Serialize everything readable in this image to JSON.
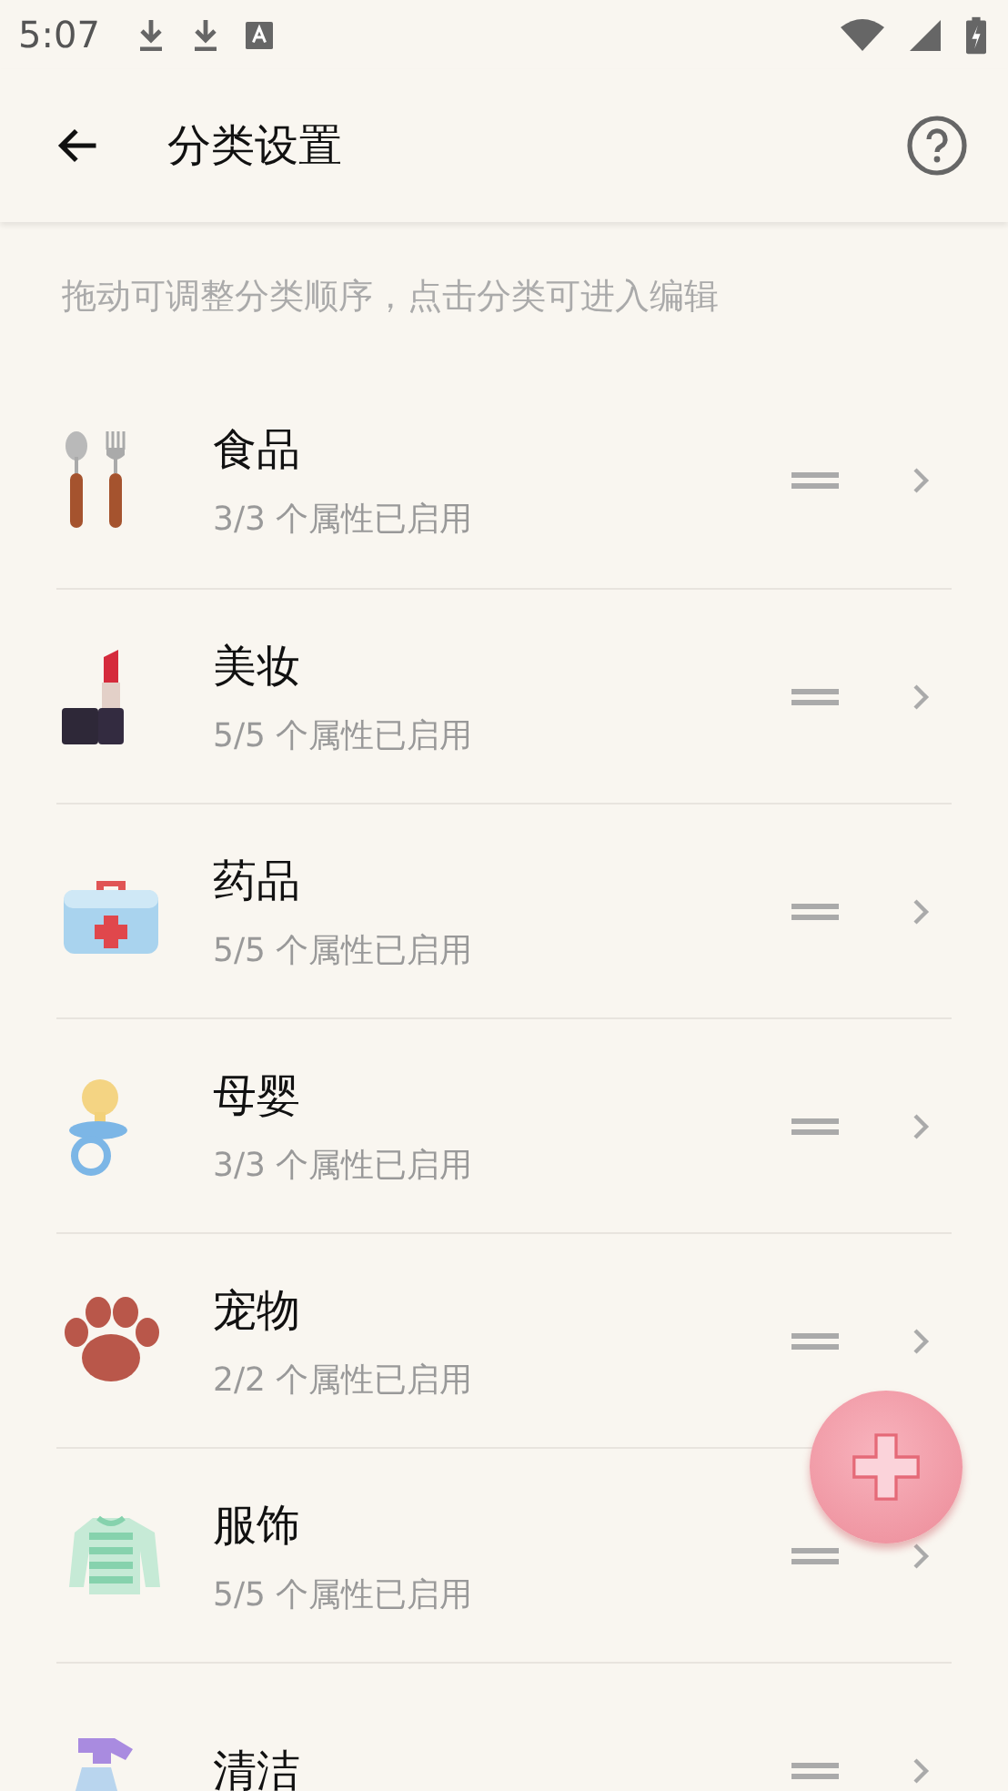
{
  "status_bar": {
    "time": "5:07"
  },
  "app_bar": {
    "title": "分类设置"
  },
  "hint": "拖动可调整分类顺序，点击分类可进入编辑",
  "categories": [
    {
      "name": "食品",
      "subtitle": "3/3 个属性已启用"
    },
    {
      "name": "美妆",
      "subtitle": "5/5 个属性已启用"
    },
    {
      "name": "药品",
      "subtitle": "5/5 个属性已启用"
    },
    {
      "name": "母婴",
      "subtitle": "3/3 个属性已启用"
    },
    {
      "name": "宠物",
      "subtitle": "2/2 个属性已启用"
    },
    {
      "name": "服饰",
      "subtitle": "5/5 个属性已启用"
    },
    {
      "name": "清洁"
    }
  ]
}
